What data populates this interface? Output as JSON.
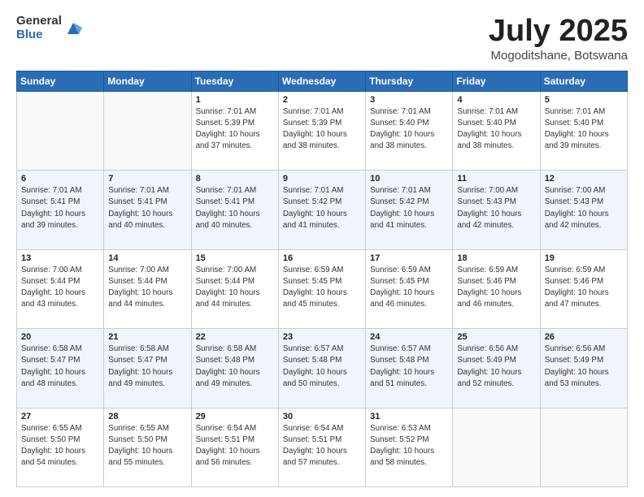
{
  "header": {
    "logo_general": "General",
    "logo_blue": "Blue",
    "month_title": "July 2025",
    "location": "Mogoditshane, Botswana"
  },
  "weekdays": [
    "Sunday",
    "Monday",
    "Tuesday",
    "Wednesday",
    "Thursday",
    "Friday",
    "Saturday"
  ],
  "weeks": [
    [
      {
        "day": "",
        "info": ""
      },
      {
        "day": "",
        "info": ""
      },
      {
        "day": "1",
        "info": "Sunrise: 7:01 AM\nSunset: 5:39 PM\nDaylight: 10 hours\nand 37 minutes."
      },
      {
        "day": "2",
        "info": "Sunrise: 7:01 AM\nSunset: 5:39 PM\nDaylight: 10 hours\nand 38 minutes."
      },
      {
        "day": "3",
        "info": "Sunrise: 7:01 AM\nSunset: 5:40 PM\nDaylight: 10 hours\nand 38 minutes."
      },
      {
        "day": "4",
        "info": "Sunrise: 7:01 AM\nSunset: 5:40 PM\nDaylight: 10 hours\nand 38 minutes."
      },
      {
        "day": "5",
        "info": "Sunrise: 7:01 AM\nSunset: 5:40 PM\nDaylight: 10 hours\nand 39 minutes."
      }
    ],
    [
      {
        "day": "6",
        "info": "Sunrise: 7:01 AM\nSunset: 5:41 PM\nDaylight: 10 hours\nand 39 minutes."
      },
      {
        "day": "7",
        "info": "Sunrise: 7:01 AM\nSunset: 5:41 PM\nDaylight: 10 hours\nand 40 minutes."
      },
      {
        "day": "8",
        "info": "Sunrise: 7:01 AM\nSunset: 5:41 PM\nDaylight: 10 hours\nand 40 minutes."
      },
      {
        "day": "9",
        "info": "Sunrise: 7:01 AM\nSunset: 5:42 PM\nDaylight: 10 hours\nand 41 minutes."
      },
      {
        "day": "10",
        "info": "Sunrise: 7:01 AM\nSunset: 5:42 PM\nDaylight: 10 hours\nand 41 minutes."
      },
      {
        "day": "11",
        "info": "Sunrise: 7:00 AM\nSunset: 5:43 PM\nDaylight: 10 hours\nand 42 minutes."
      },
      {
        "day": "12",
        "info": "Sunrise: 7:00 AM\nSunset: 5:43 PM\nDaylight: 10 hours\nand 42 minutes."
      }
    ],
    [
      {
        "day": "13",
        "info": "Sunrise: 7:00 AM\nSunset: 5:44 PM\nDaylight: 10 hours\nand 43 minutes."
      },
      {
        "day": "14",
        "info": "Sunrise: 7:00 AM\nSunset: 5:44 PM\nDaylight: 10 hours\nand 44 minutes."
      },
      {
        "day": "15",
        "info": "Sunrise: 7:00 AM\nSunset: 5:44 PM\nDaylight: 10 hours\nand 44 minutes."
      },
      {
        "day": "16",
        "info": "Sunrise: 6:59 AM\nSunset: 5:45 PM\nDaylight: 10 hours\nand 45 minutes."
      },
      {
        "day": "17",
        "info": "Sunrise: 6:59 AM\nSunset: 5:45 PM\nDaylight: 10 hours\nand 46 minutes."
      },
      {
        "day": "18",
        "info": "Sunrise: 6:59 AM\nSunset: 5:46 PM\nDaylight: 10 hours\nand 46 minutes."
      },
      {
        "day": "19",
        "info": "Sunrise: 6:59 AM\nSunset: 5:46 PM\nDaylight: 10 hours\nand 47 minutes."
      }
    ],
    [
      {
        "day": "20",
        "info": "Sunrise: 6:58 AM\nSunset: 5:47 PM\nDaylight: 10 hours\nand 48 minutes."
      },
      {
        "day": "21",
        "info": "Sunrise: 6:58 AM\nSunset: 5:47 PM\nDaylight: 10 hours\nand 49 minutes."
      },
      {
        "day": "22",
        "info": "Sunrise: 6:58 AM\nSunset: 5:48 PM\nDaylight: 10 hours\nand 49 minutes."
      },
      {
        "day": "23",
        "info": "Sunrise: 6:57 AM\nSunset: 5:48 PM\nDaylight: 10 hours\nand 50 minutes."
      },
      {
        "day": "24",
        "info": "Sunrise: 6:57 AM\nSunset: 5:48 PM\nDaylight: 10 hours\nand 51 minutes."
      },
      {
        "day": "25",
        "info": "Sunrise: 6:56 AM\nSunset: 5:49 PM\nDaylight: 10 hours\nand 52 minutes."
      },
      {
        "day": "26",
        "info": "Sunrise: 6:56 AM\nSunset: 5:49 PM\nDaylight: 10 hours\nand 53 minutes."
      }
    ],
    [
      {
        "day": "27",
        "info": "Sunrise: 6:55 AM\nSunset: 5:50 PM\nDaylight: 10 hours\nand 54 minutes."
      },
      {
        "day": "28",
        "info": "Sunrise: 6:55 AM\nSunset: 5:50 PM\nDaylight: 10 hours\nand 55 minutes."
      },
      {
        "day": "29",
        "info": "Sunrise: 6:54 AM\nSunset: 5:51 PM\nDaylight: 10 hours\nand 56 minutes."
      },
      {
        "day": "30",
        "info": "Sunrise: 6:54 AM\nSunset: 5:51 PM\nDaylight: 10 hours\nand 57 minutes."
      },
      {
        "day": "31",
        "info": "Sunrise: 6:53 AM\nSunset: 5:52 PM\nDaylight: 10 hours\nand 58 minutes."
      },
      {
        "day": "",
        "info": ""
      },
      {
        "day": "",
        "info": ""
      }
    ]
  ]
}
